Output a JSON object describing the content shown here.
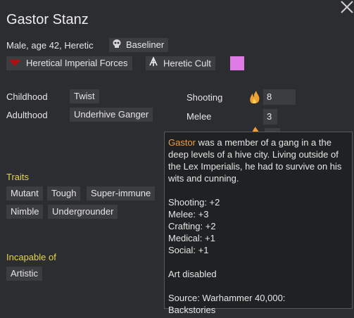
{
  "character": {
    "name": "Gastor Stanz",
    "description": "Male, age 42, Heretic",
    "xenotype": "Baseliner",
    "faction": "Heretical Imperial Forces",
    "ideology": "Heretic Cult",
    "ideology_color": "#e07ae6"
  },
  "backstory": {
    "childhood_label": "Childhood",
    "childhood_value": "Twist",
    "adulthood_label": "Adulthood",
    "adulthood_value": "Underhive Ganger"
  },
  "skills": {
    "shooting_label": "Shooting",
    "shooting_value": "8",
    "melee_label": "Melee",
    "melee_value": "3"
  },
  "traits": {
    "heading": "Traits",
    "items": [
      "Mutant",
      "Tough",
      "Super-immune",
      "Nimble",
      "Undergrounder"
    ]
  },
  "incapable": {
    "heading": "Incapable of",
    "items": [
      "Artistic"
    ]
  },
  "tooltip": {
    "name": "Gastor",
    "description": " was a member of a gang in a the deep levels of a hive city. Living outside of the Lex Imperialis, he had to survive on his wits and cunning.",
    "stats": [
      "Shooting: +2",
      "Melee: +3",
      "Crafting: +2",
      "Medical: +1",
      "Social: +1"
    ],
    "disabled": "Art disabled",
    "source_line1": "Source: Warhammer 40,000:",
    "source_line2": "Backstories"
  },
  "colors": {
    "background": "#2b2d30",
    "chip": "#3b3d41",
    "heading_yellow": "#e6d64a",
    "name_orange": "#e8a04c",
    "passion_flame": "#f0a030"
  },
  "icons": {
    "close": "close-icon",
    "xenotype": "skull-icon",
    "faction": "faction-emblem-icon",
    "ideology": "ideology-symbol-icon",
    "passion": "flame-icon"
  }
}
